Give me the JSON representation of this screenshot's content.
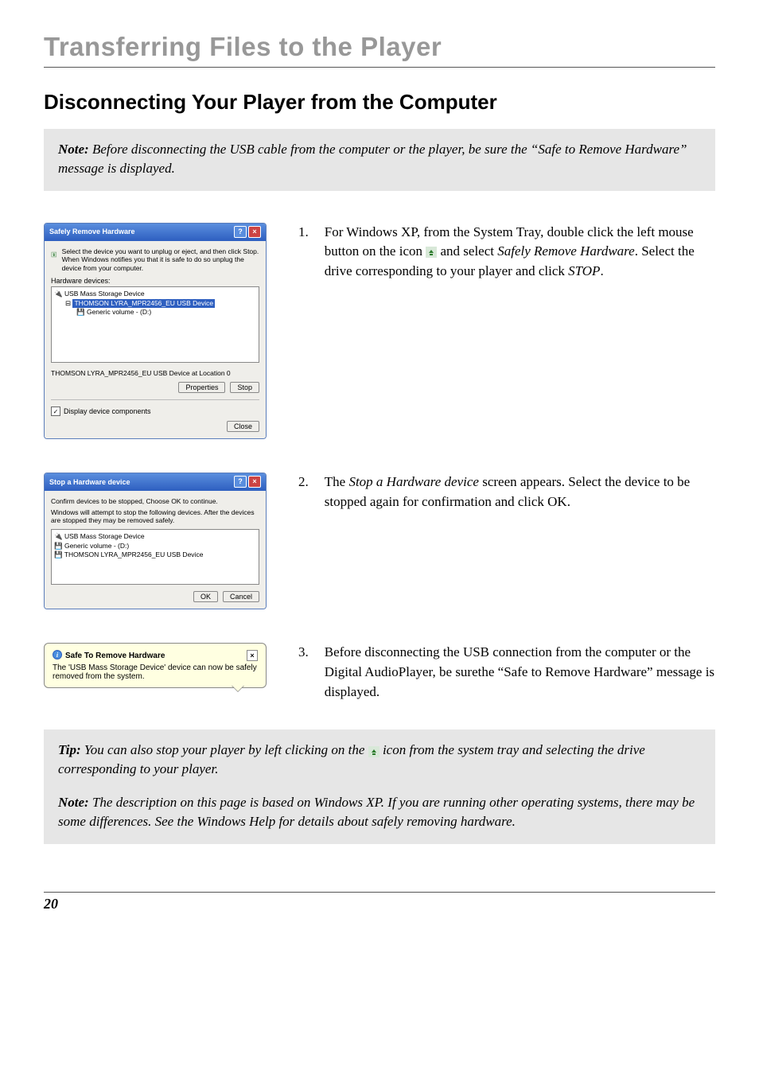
{
  "page": {
    "number": "20"
  },
  "headings": {
    "main": "Transferring Files to the Player",
    "section": "Disconnecting Your Player from the Computer"
  },
  "note1": {
    "label": "Note:",
    "text": " Before disconnecting the USB cable from the computer or the player, be sure the “Safe to Remove Hardware” message is displayed."
  },
  "steps": {
    "s1": {
      "num": "1.",
      "pre": "For Windows XP, from the System Tray, double click the left mouse button on the icon ",
      "post": " and select ",
      "ital1": "Safely Remove Hardware",
      "mid2": ". Select the drive corresponding to your player and click ",
      "ital2": "STOP",
      "end": "."
    },
    "s2": {
      "num": "2.",
      "pre": "The ",
      "ital": "Stop a Hardware device",
      "post": " screen appears. Select the device to be stopped again for confirmation and click OK."
    },
    "s3": {
      "num": "3.",
      "text": "Before disconnecting the USB connection from the computer or the Digital AudioPlayer, be surethe “Safe to Remove Hardware” message is displayed."
    }
  },
  "dialog1": {
    "title": "Safely Remove Hardware",
    "intro": "Select the device you want to unplug or eject, and then click Stop. When Windows notifies you that it is safe to do so unplug the device from your computer.",
    "hw_label": "Hardware devices:",
    "item_usb": "USB Mass Storage Device",
    "item_sel": "THOMSON LYRA_MPR2456_EU USB Device",
    "item_vol": "Generic volume - (D:)",
    "status": "THOMSON LYRA_MPR2456_EU USB Device at Location 0",
    "btn_props": "Properties",
    "btn_stop": "Stop",
    "chk": "Display device components",
    "btn_close": "Close"
  },
  "dialog2": {
    "title": "Stop a Hardware device",
    "line1": "Confirm devices to be stopped, Choose OK to continue.",
    "line2": "Windows will attempt to stop the following devices. After the devices are stopped they may be removed safely.",
    "item1": "USB Mass Storage Device",
    "item2": "Generic volume - (D:)",
    "item3": "THOMSON LYRA_MPR2456_EU USB Device",
    "btn_ok": "OK",
    "btn_cancel": "Cancel"
  },
  "balloon": {
    "title": "Safe To Remove Hardware",
    "msg": "The 'USB Mass Storage Device' device can now be safely removed from the system."
  },
  "tip": {
    "label": "Tip:",
    "text_pre": " You can also stop your player by left clicking on the ",
    "text_post": " icon from the system tray and selecting the drive corresponding to your player."
  },
  "note2": {
    "label": "Note:",
    "text": " The description on this page is based on Windows XP. If you are running other operating systems, there may be some differences. See the Windows Help for details about safely removing hardware."
  },
  "icons": {
    "usb_icon_color_bg": "#c8d8c8",
    "usb_icon_color_fg": "#2a7a2a"
  }
}
